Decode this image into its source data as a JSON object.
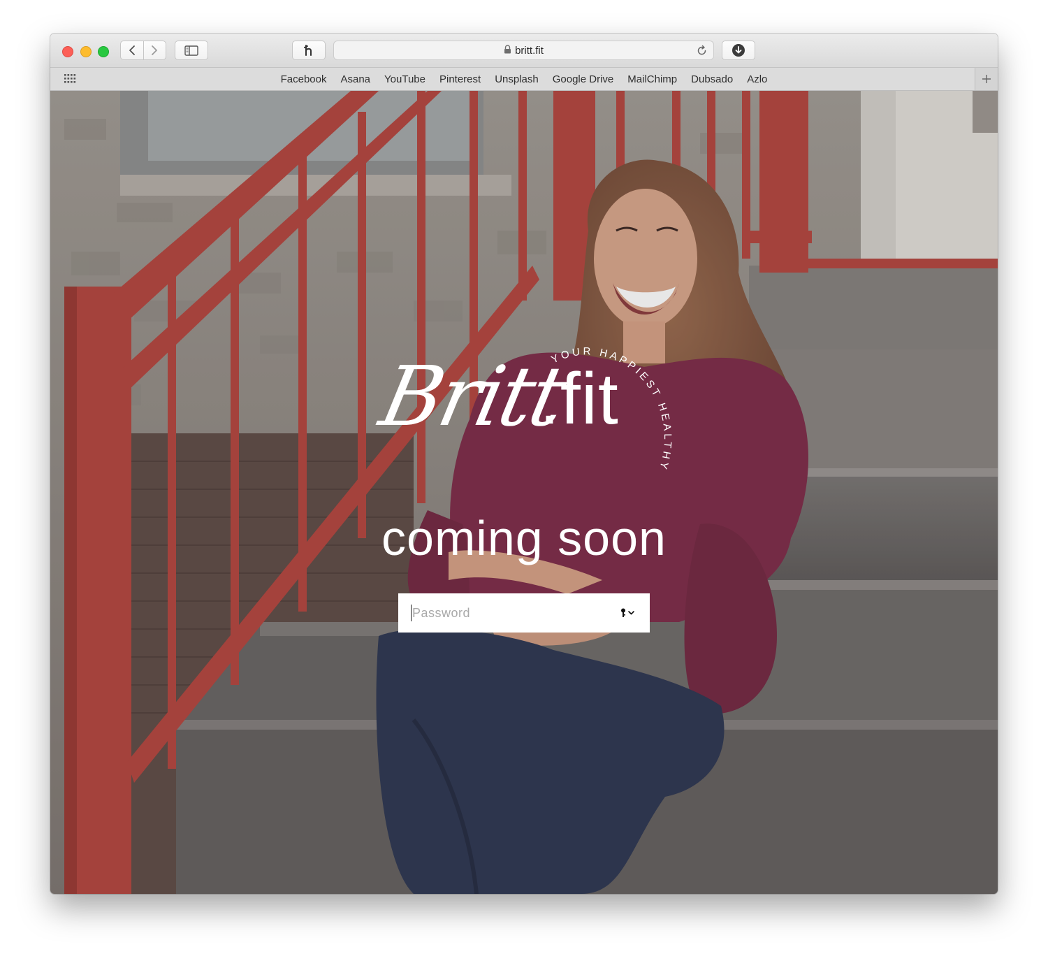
{
  "browser": {
    "url": "britt.fit",
    "favorites": [
      "Facebook",
      "Asana",
      "YouTube",
      "Pinterest",
      "Unsplash",
      "Google Drive",
      "MailChimp",
      "Dubsado",
      "Azlo"
    ],
    "icons": {
      "back": "chevron-left-icon",
      "forward": "chevron-right-icon",
      "sidebar": "sidebar-icon",
      "extension": "honey-extension-icon",
      "lock": "lock-icon",
      "reload": "reload-icon",
      "download": "download-icon",
      "favorites_grid": "grid-icon",
      "new_tab": "plus-icon"
    }
  },
  "page": {
    "logo": {
      "script": "Britt",
      "suffix": ".fit",
      "tagline": "YOUR HAPPIEST HEALTHY"
    },
    "headline": "coming soon",
    "password": {
      "placeholder": "Password",
      "value": "",
      "icon": "key-icon"
    }
  },
  "colors": {
    "railing_red": "#b5403a",
    "shirt": "#7d2a47",
    "text_white": "#ffffff"
  }
}
